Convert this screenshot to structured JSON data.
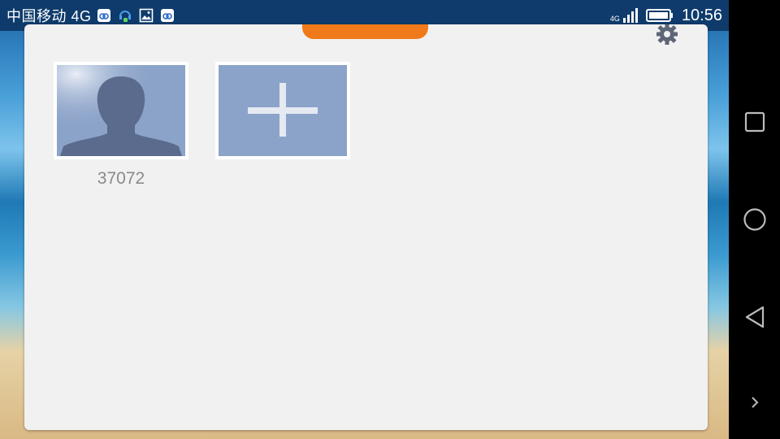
{
  "status_bar": {
    "carrier": "中国移动 4G",
    "network_badge": "4G",
    "time": "10:56",
    "left_icons": [
      "baidu-cloud-icon",
      "headset-notification-icon",
      "image-icon",
      "baidu-cloud-icon"
    ],
    "right_icons": [
      "signal-icon",
      "battery-icon"
    ]
  },
  "navigation": {
    "buttons": [
      "recent-apps-icon",
      "home-icon",
      "back-icon",
      "expand-icon"
    ]
  },
  "card": {
    "top_tab_color": "#f07a1a",
    "settings_icon": "gear-icon"
  },
  "accounts": [
    {
      "label": "37072",
      "avatar": "default-avatar-icon"
    }
  ],
  "add_account": {
    "icon": "plus-icon"
  }
}
